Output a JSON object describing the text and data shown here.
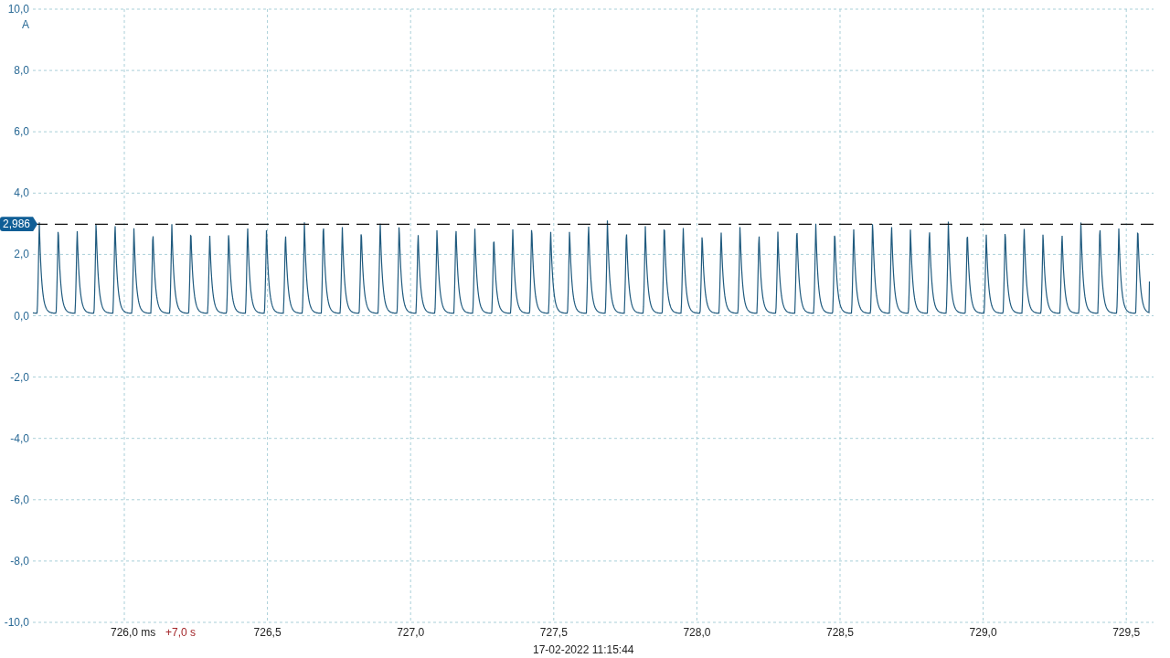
{
  "y_axis": {
    "unit": "A",
    "ticks": [
      "10,0",
      "8,0",
      "6,0",
      "4,0",
      "2,0",
      "0,0",
      "-2,0",
      "-4,0",
      "-6,0",
      "-8,0",
      "-10,0"
    ]
  },
  "x_axis": {
    "ticks": [
      "726,0 ms",
      "726,5",
      "727,0",
      "727,5",
      "728,0",
      "728,5",
      "729,0",
      "729,5"
    ],
    "offset": "+7,0 s",
    "timestamp": "17-02-2022 11:15:44"
  },
  "ruler": {
    "value": "2,986"
  }
}
